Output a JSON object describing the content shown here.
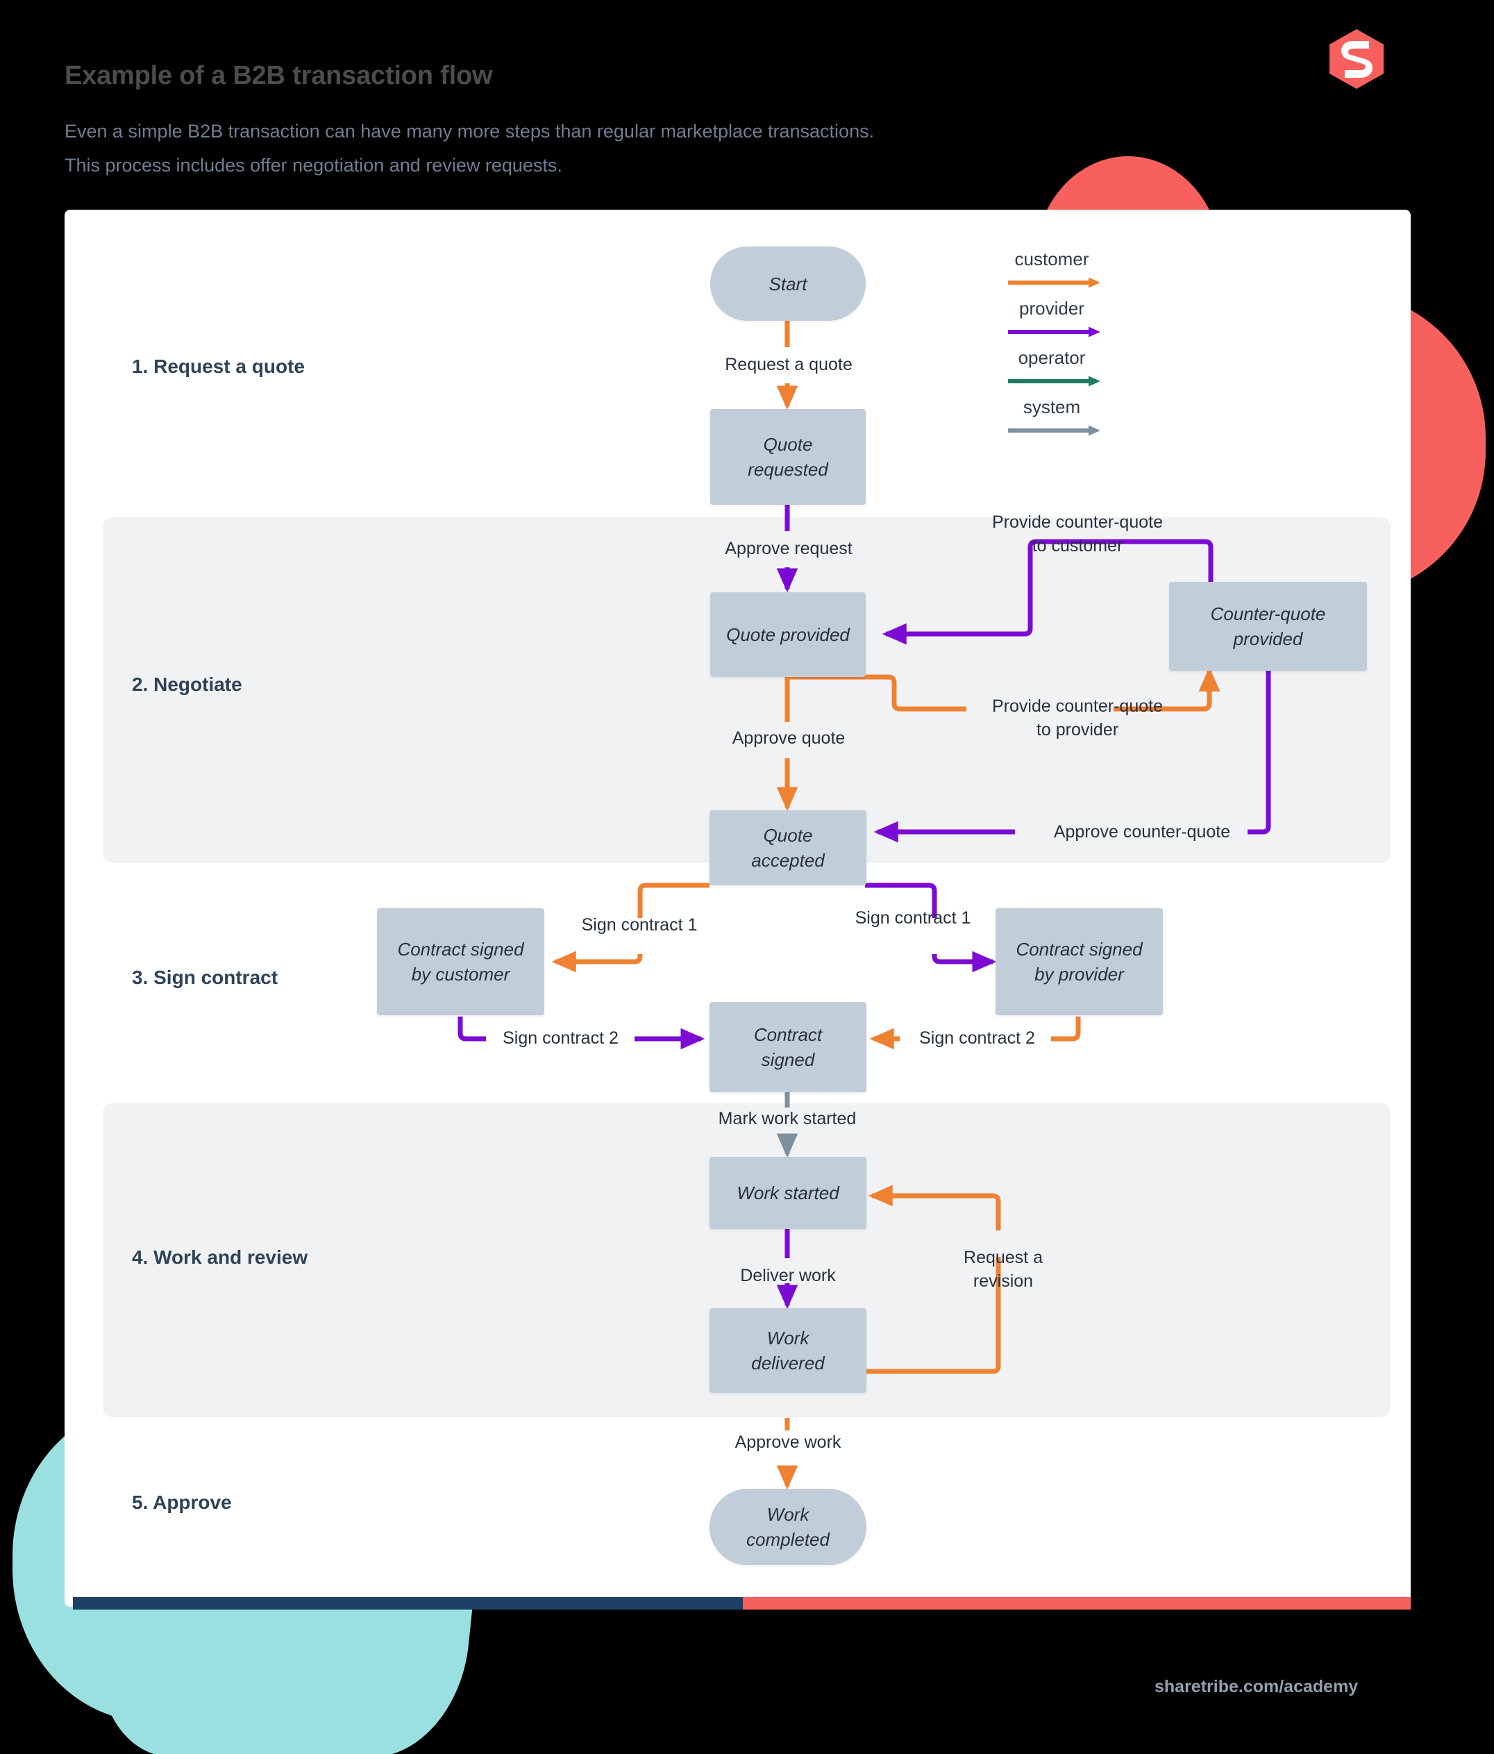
{
  "header": {
    "title": "Example of a B2B transaction flow",
    "subtitle_line1": "Even a simple B2B transaction can have many more steps than regular marketplace transactions.",
    "subtitle_line2": "This process includes offer negotiation and review requests."
  },
  "footer": {
    "url": "sharetribe.com/academy"
  },
  "colors": {
    "customer": "#ee8132",
    "provider": "#7b0bd4",
    "operator": "#1d7a63",
    "system": "#7d909f",
    "node_fill": "#c1cdd8",
    "node_text": "#27313d",
    "band": "#f1f2f4",
    "card": "#ffffff",
    "brand_coral": "#f8605e",
    "brand_teal": "#9ae0e0",
    "brand_navy": "#1c4165",
    "stage_label": "#2e4257",
    "title": "#4c4c4c",
    "subtitle": "#707e92",
    "background": "#000000"
  },
  "legend": {
    "items": [
      {
        "label": "customer",
        "color": "#ee8132"
      },
      {
        "label": "provider",
        "color": "#7b0bd4"
      },
      {
        "label": "operator",
        "color": "#1d7a63"
      },
      {
        "label": "system",
        "color": "#7d909f"
      }
    ]
  },
  "stages": [
    {
      "id": "stage-1",
      "label": "1. Request a quote"
    },
    {
      "id": "stage-2",
      "label": "2. Negotiate"
    },
    {
      "id": "stage-3",
      "label": "3. Sign contract"
    },
    {
      "id": "stage-4",
      "label": "4. Work and review"
    },
    {
      "id": "stage-5",
      "label": "5. Approve"
    }
  ],
  "nodes": [
    {
      "id": "start",
      "label": "Start",
      "shape": "pill"
    },
    {
      "id": "quote-requested",
      "label": "Quote\nrequested",
      "shape": "rect"
    },
    {
      "id": "quote-provided",
      "label": "Quote provided",
      "shape": "rect"
    },
    {
      "id": "counter-quote",
      "label": "Counter-quote\nprovided",
      "shape": "rect"
    },
    {
      "id": "quote-accepted",
      "label": "Quote\naccepted",
      "shape": "rect"
    },
    {
      "id": "signed-customer",
      "label": "Contract signed\nby customer",
      "shape": "rect"
    },
    {
      "id": "signed-provider",
      "label": "Contract signed\nby provider",
      "shape": "rect"
    },
    {
      "id": "contract-signed",
      "label": "Contract\nsigned",
      "shape": "rect"
    },
    {
      "id": "work-started",
      "label": "Work started",
      "shape": "rect"
    },
    {
      "id": "work-delivered",
      "label": "Work\ndelivered",
      "shape": "rect"
    },
    {
      "id": "work-completed",
      "label": "Work\ncompleted",
      "shape": "pill"
    }
  ],
  "transitions": [
    {
      "id": "t-request-quote",
      "label": "Request a quote",
      "actor": "customer",
      "from": "start",
      "to": "quote-requested"
    },
    {
      "id": "t-approve-request",
      "label": "Approve request",
      "actor": "provider",
      "from": "quote-requested",
      "to": "quote-provided"
    },
    {
      "id": "t-counter-to-provider",
      "label": "Provide counter-quote\nto provider",
      "actor": "customer",
      "from": "quote-provided",
      "to": "counter-quote"
    },
    {
      "id": "t-counter-to-customer",
      "label": "Provide counter-quote\nto customer",
      "actor": "provider",
      "from": "counter-quote",
      "to": "quote-provided"
    },
    {
      "id": "t-approve-quote",
      "label": "Approve quote",
      "actor": "customer",
      "from": "quote-provided",
      "to": "quote-accepted"
    },
    {
      "id": "t-approve-counter",
      "label": "Approve counter-quote",
      "actor": "provider",
      "from": "counter-quote",
      "to": "quote-accepted"
    },
    {
      "id": "t-sign1-customer",
      "label": "Sign contract 1",
      "actor": "customer",
      "from": "quote-accepted",
      "to": "signed-customer"
    },
    {
      "id": "t-sign1-provider",
      "label": "Sign contract 1",
      "actor": "provider",
      "from": "quote-accepted",
      "to": "signed-provider"
    },
    {
      "id": "t-sign2-left",
      "label": "Sign contract 2",
      "actor": "provider",
      "from": "signed-customer",
      "to": "contract-signed"
    },
    {
      "id": "t-sign2-right",
      "label": "Sign contract 2",
      "actor": "customer",
      "from": "signed-provider",
      "to": "contract-signed"
    },
    {
      "id": "t-mark-work-started",
      "label": "Mark work started",
      "actor": "system",
      "from": "contract-signed",
      "to": "work-started"
    },
    {
      "id": "t-deliver-work",
      "label": "Deliver work",
      "actor": "provider",
      "from": "work-started",
      "to": "work-delivered"
    },
    {
      "id": "t-request-revision",
      "label": "Request a\nrevision",
      "actor": "customer",
      "from": "work-delivered",
      "to": "work-started"
    },
    {
      "id": "t-approve-work",
      "label": "Approve work",
      "actor": "customer",
      "from": "work-delivered",
      "to": "work-completed"
    }
  ]
}
